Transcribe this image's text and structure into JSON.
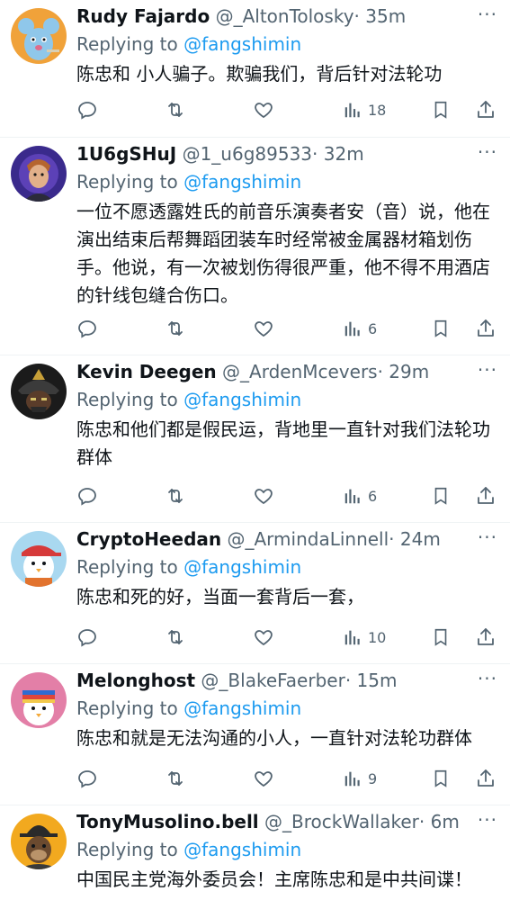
{
  "colors": {
    "link": "#1d9bf0",
    "muted": "#536471",
    "text": "#0f1419",
    "divider": "#eff3f4"
  },
  "replies": [
    {
      "name": "Rudy Fajardo",
      "handle": "@_AltonTolosky",
      "time": "· 35m",
      "replying_prefix": "Replying to ",
      "replying_to": "@fangshimin",
      "text": "陈忠和 小人骗子。欺骗我们，背后针对法轮功",
      "views": "18",
      "avatar_icon": "blue-mouse-cartoon-avatar-icon"
    },
    {
      "name": "1U6gSHuJ",
      "handle": "@1_u6g89533",
      "time": "· 32m",
      "replying_prefix": "Replying to ",
      "replying_to": "@fangshimin",
      "text": "一位不愿透露姓氏的前音乐演奏者安（音）说，他在演出结束后帮舞蹈团装车时经常被金属器材箱划伤手。他说，有一次被划伤得很严重，他不得不用酒店的针线包缝合伤口。",
      "views": "6",
      "avatar_icon": "3d-character-avatar-icon"
    },
    {
      "name": "Kevin Deegen",
      "handle": "@_ArdenMcevers",
      "time": "· 29m",
      "replying_prefix": "Replying to ",
      "replying_to": "@fangshimin",
      "text": "陈忠和他们都是假民运，背地里一直针对我们法轮功群体",
      "views": "6",
      "avatar_icon": "samurai-helmet-avatar-icon"
    },
    {
      "name": "CryptoHeedan",
      "handle": "@_ArmindaLinnell",
      "time": "· 24m",
      "replying_prefix": "Replying to ",
      "replying_to": "@fangshimin",
      "text": "陈忠和死的好，当面一套背后一套，",
      "views": "10",
      "avatar_icon": "penguin-red-cap-avatar-icon"
    },
    {
      "name": "Melonghost",
      "handle": "@_BlakeFaerber",
      "time": "· 15m",
      "replying_prefix": "Replying to ",
      "replying_to": "@fangshimin",
      "text": "陈忠和就是无法沟通的小人，一直针对法轮功群体",
      "views": "9",
      "avatar_icon": "penguin-striped-hat-avatar-icon"
    },
    {
      "name": "TonyMusolino.bell",
      "handle": "@_BrockWallaker",
      "time": "· 6m",
      "replying_prefix": "Replying to ",
      "replying_to": "@fangshimin",
      "text": "中国民主党海外委员会！主席陈忠和是中共间谍！",
      "views": "",
      "avatar_icon": "ape-fedora-avatar-icon"
    }
  ]
}
